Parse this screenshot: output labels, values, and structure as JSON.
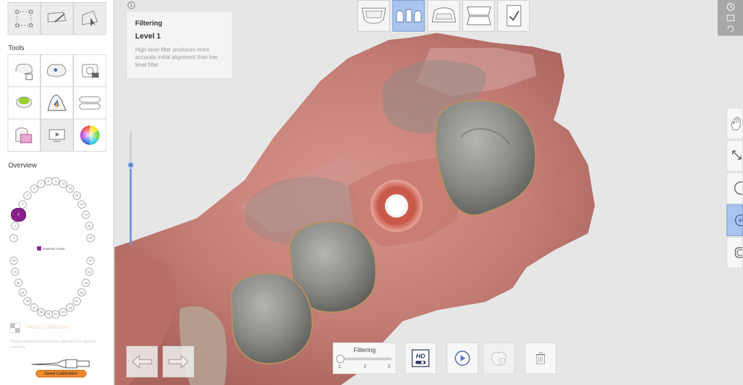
{
  "sidebar": {
    "tools_label": "Tools",
    "overview_label": "Overview",
    "top_tools": [
      "select-region-icon",
      "lasso-brush-icon",
      "cursor-eraser-icon"
    ],
    "tools": [
      "tooth-lock-icon",
      "tooth-pin-icon",
      "screenshot-icon",
      "tooth-color-icon",
      "tooth-shade-icon",
      "arch-icon",
      "layer-icon",
      "video-icon",
      "color-wheel-icon"
    ],
    "tooth_chart": {
      "upper": [
        "1",
        "2",
        "3",
        "4",
        "5",
        "6",
        "7",
        "8",
        "9",
        "10",
        "11",
        "12",
        "13",
        "14",
        "15",
        "16"
      ],
      "lower": [
        "17",
        "18",
        "19",
        "20",
        "21",
        "22",
        "23",
        "24",
        "25",
        "26",
        "27",
        "28",
        "29",
        "30",
        "31",
        "32"
      ],
      "selected_tooth": "3",
      "legend": "Anatomic crown",
      "legend_color": "#8a1f8c"
    },
    "calibration": {
      "title": "Need Calibration",
      "description": "Please repeat performing the calibration for optimal scanning.",
      "button": "Need Calibration"
    }
  },
  "info_panel": {
    "icon": "i",
    "title": "Filtering",
    "level": "Level 1",
    "description": "High level filter produces more accurate initial alignment than low level filter."
  },
  "top_steps": [
    {
      "name": "upper-jaw-icon",
      "active": false
    },
    {
      "name": "abutment-icon",
      "active": true
    },
    {
      "name": "lower-jaw-icon",
      "active": false
    },
    {
      "name": "occlusion-icon",
      "active": false
    },
    {
      "name": "checklist-icon",
      "active": false
    }
  ],
  "left_slider": {
    "value": 0.29
  },
  "bottom_toolbar": {
    "filter_label": "Filtering",
    "ticks": [
      "1",
      "2",
      "3"
    ],
    "filter_value": "1",
    "hd_label": "HD"
  },
  "right_toolbar": [
    "hand-icon",
    "fit-view-icon",
    "circle-icon",
    "zoom-in-icon",
    "layers-icon"
  ],
  "colors": {
    "accent": "#a9c4ee",
    "orange": "#f0892c",
    "selected_tooth": "#8a1f8c"
  }
}
